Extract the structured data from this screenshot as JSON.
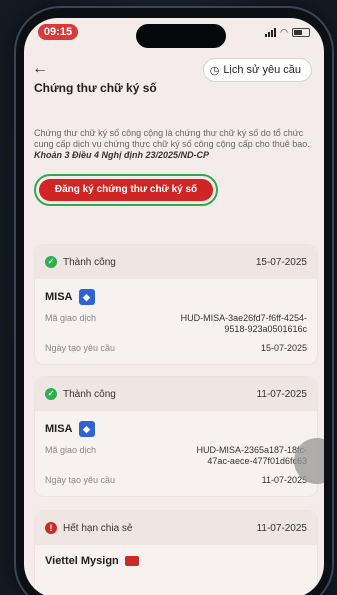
{
  "status_bar": {
    "time": "09:15"
  },
  "nav": {
    "back_icon": "arrow-left-icon",
    "history_label": "Lịch sử yêu cầu",
    "history_icon": "clock-history-icon"
  },
  "page": {
    "title": "Chứng thư chữ ký số"
  },
  "description": {
    "text": "Chứng thư chữ ký số công cộng là chứng thư chữ ký số do tổ chức cung cấp dịch vụ chứng thực chữ ký số công cộng cấp cho thuê bao.",
    "citation": "Khoản 3 Điều 4 Nghị định 23/2025/ND-CP"
  },
  "register_button": {
    "label": "Đăng ký chứng thư chữ ký số"
  },
  "cards": [
    {
      "status": "Thành công",
      "date": "15-07-2025",
      "provider": "MISA",
      "tx_label": "Mã giao dịch",
      "tx_value": "HUD-MISA-3ae26fd7-f6ff-4254-9518-923a0501616c",
      "created_label": "Ngày tạo yêu cầu",
      "created_value": "15-07-2025"
    },
    {
      "status": "Thành công",
      "date": "11-07-2025",
      "provider": "MISA",
      "tx_label": "Mã giao dịch",
      "tx_value": "HUD-MISA-2365a187-18fc-47ac-aece-477f01d6fc63",
      "created_label": "Ngày tạo yêu cầu",
      "created_value": "11-07-2025"
    },
    {
      "status": "Hết hạn chia sẻ",
      "date": "11-07-2025",
      "provider": "Viettel Mysign"
    }
  ],
  "colors": {
    "accent": "#cf2525",
    "success": "#2bb04a",
    "highlight": "#32a84a"
  }
}
